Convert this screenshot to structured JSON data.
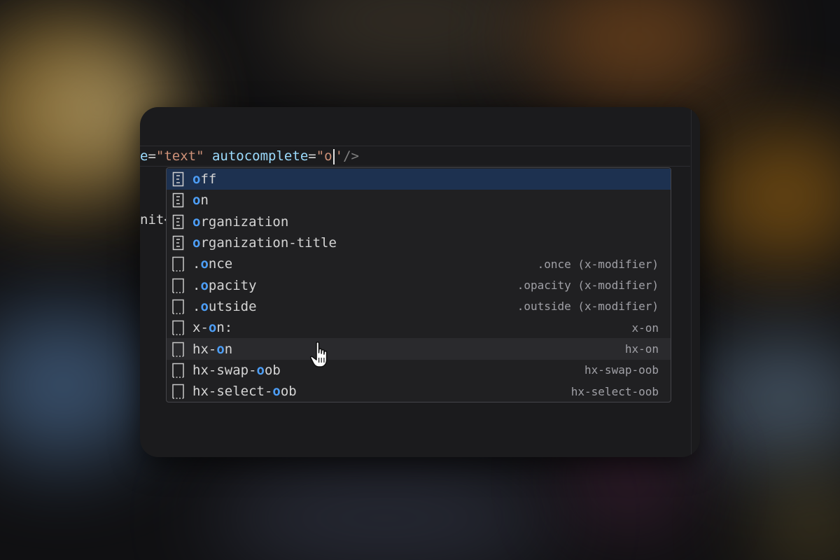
{
  "editor": {
    "code_line": {
      "prefix_attr": "e",
      "prefix_eq": "=",
      "prefix_value": "\"text\"",
      "attr": " autocomplete",
      "eq": "=",
      "value_open": "\"o",
      "value_close": "'",
      "tail": "/>"
    },
    "code_line_2": "nit<"
  },
  "suggestions": {
    "selected_index": 0,
    "hover_index": 8,
    "items": [
      {
        "icon": "value-icon",
        "hl": "o",
        "rest": "ff",
        "pre": "",
        "detail": ""
      },
      {
        "icon": "value-icon",
        "hl": "o",
        "rest": "n",
        "pre": "",
        "detail": ""
      },
      {
        "icon": "value-icon",
        "hl": "o",
        "rest": "rganization",
        "pre": "",
        "detail": ""
      },
      {
        "icon": "value-icon",
        "hl": "o",
        "rest": "rganization-title",
        "pre": "",
        "detail": ""
      },
      {
        "icon": "snippet-icon",
        "pre": ".",
        "hl": "o",
        "rest": "nce",
        "detail": ".once (x-modifier)"
      },
      {
        "icon": "snippet-icon",
        "pre": ".",
        "hl": "o",
        "rest": "pacity",
        "detail": ".opacity (x-modifier)"
      },
      {
        "icon": "snippet-icon",
        "pre": ".",
        "hl": "o",
        "rest": "utside",
        "detail": ".outside (x-modifier)"
      },
      {
        "icon": "snippet-icon",
        "pre": "x-",
        "hl": "o",
        "rest": "n:",
        "detail": "x-on"
      },
      {
        "icon": "snippet-icon",
        "pre": "hx-",
        "hl": "o",
        "rest": "n",
        "detail": "hx-on"
      },
      {
        "icon": "snippet-icon",
        "pre": "hx-swap-",
        "hl": "o",
        "rest": "ob",
        "detail": "hx-swap-oob"
      },
      {
        "icon": "snippet-icon",
        "pre": "hx-select-",
        "hl": "o",
        "rest": "ob",
        "detail": "hx-select-oob"
      }
    ]
  },
  "colors": {
    "highlight": "#4d9ef6",
    "selected_row": "#1d3150",
    "hover_row": "#2a2a2d",
    "string": "#ce9178",
    "attribute": "#9cdcfe"
  },
  "mouse_cursor": "pointer-hand-icon"
}
